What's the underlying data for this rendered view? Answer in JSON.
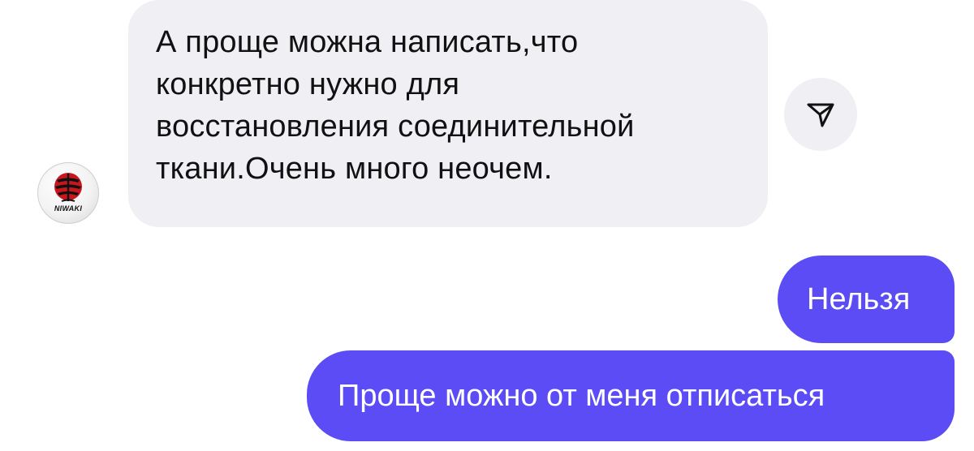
{
  "incoming_message": {
    "lines": [
      "А проще можна написать,что",
      "конкретно нужно для",
      "восстановления соединительной",
      "ткани.Очень много неочем."
    ]
  },
  "avatar": {
    "logo_text": "NIWAKI",
    "colors": {
      "red": "#c8161d",
      "black": "#111111"
    }
  },
  "share_button": {
    "icon": "send-icon"
  },
  "outgoing_messages": [
    {
      "text": "Нельзя"
    },
    {
      "text": "Проще можно от меня отписаться"
    }
  ],
  "colors": {
    "outgoing_bubble": "#5b4cf5",
    "incoming_bubble": "#efeff4",
    "incoming_text": "#111111",
    "outgoing_text": "#ffffff"
  }
}
